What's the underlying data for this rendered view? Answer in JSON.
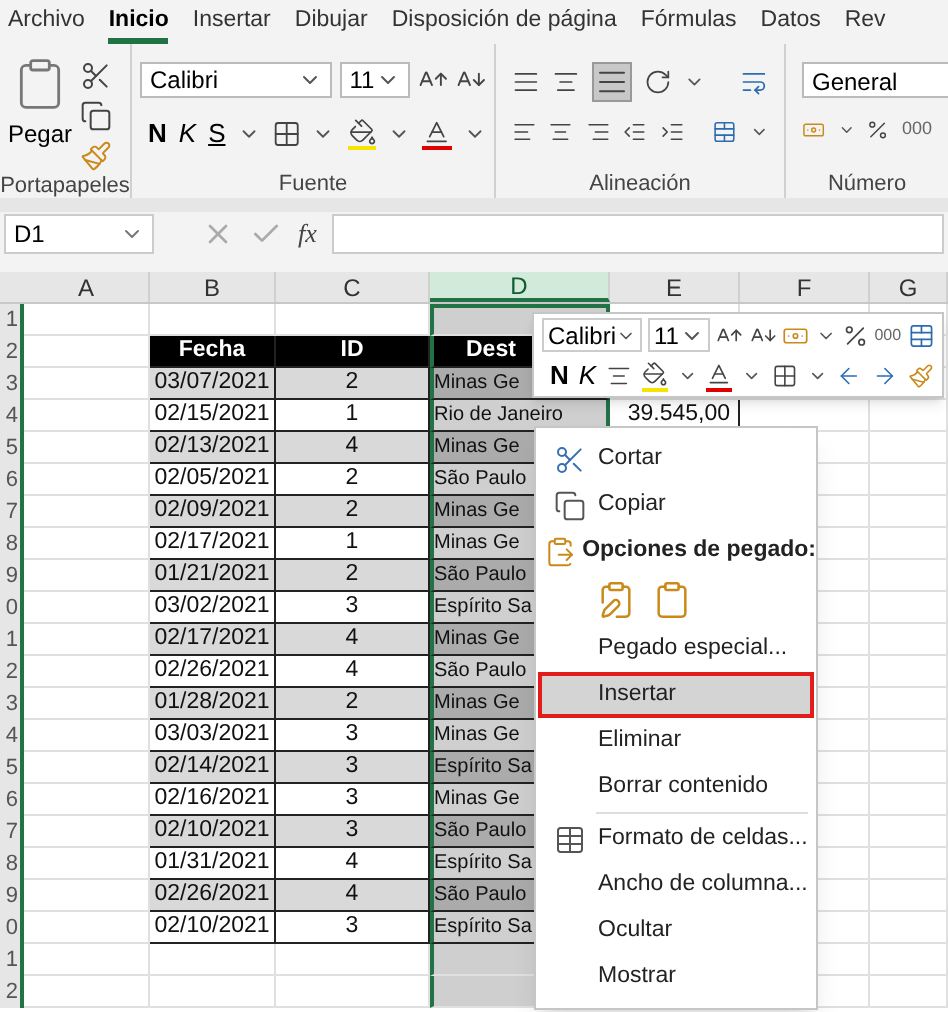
{
  "tabs": [
    {
      "label": "Archivo",
      "selected": false
    },
    {
      "label": "Inicio",
      "selected": true
    },
    {
      "label": "Insertar",
      "selected": false
    },
    {
      "label": "Dibujar",
      "selected": false
    },
    {
      "label": "Disposición de página",
      "selected": false
    },
    {
      "label": "Fórmulas",
      "selected": false
    },
    {
      "label": "Datos",
      "selected": false
    },
    {
      "label": "Rev",
      "selected": false
    }
  ],
  "ribbon": {
    "paste_label": "Pegar",
    "font": "Calibri",
    "font_size": "11",
    "bold": "N",
    "italic": "K",
    "underline": "S",
    "number_format": "General",
    "thousands": "000",
    "groups": [
      "Portapapeles",
      "Fuente",
      "Alineación",
      "Número"
    ]
  },
  "formula_bar": {
    "name_box": "D1",
    "fx": "fx"
  },
  "columns": [
    {
      "label": "A",
      "selected": false
    },
    {
      "label": "B",
      "selected": false
    },
    {
      "label": "C",
      "selected": false
    },
    {
      "label": "D",
      "selected": true
    },
    {
      "label": "E",
      "selected": false
    },
    {
      "label": "F",
      "selected": false
    },
    {
      "label": "G",
      "selected": false
    }
  ],
  "row_numbers": [
    "1",
    "2",
    "3",
    "4",
    "5",
    "6",
    "7",
    "8",
    "9",
    "0",
    "1",
    "2",
    "3",
    "4",
    "5",
    "6",
    "7",
    "8",
    "9",
    "0",
    "1",
    "2"
  ],
  "table": {
    "headers": [
      "Fecha",
      "ID",
      "Dest"
    ],
    "rows": [
      {
        "fecha": "03/07/2021",
        "id": "2",
        "dest": "Minas Ge"
      },
      {
        "fecha": "02/15/2021",
        "id": "1",
        "dest": "Rio de Janeiro"
      },
      {
        "fecha": "02/13/2021",
        "id": "4",
        "dest": "Minas Ge"
      },
      {
        "fecha": "02/05/2021",
        "id": "2",
        "dest": "São Paulo"
      },
      {
        "fecha": "02/09/2021",
        "id": "2",
        "dest": "Minas Ge"
      },
      {
        "fecha": "02/17/2021",
        "id": "1",
        "dest": "Minas Ge"
      },
      {
        "fecha": "01/21/2021",
        "id": "2",
        "dest": "São Paulo"
      },
      {
        "fecha": "03/02/2021",
        "id": "3",
        "dest": "Espírito Sa"
      },
      {
        "fecha": "02/17/2021",
        "id": "4",
        "dest": "Minas Ge"
      },
      {
        "fecha": "02/26/2021",
        "id": "4",
        "dest": "São Paulo"
      },
      {
        "fecha": "01/28/2021",
        "id": "2",
        "dest": "Minas Ge"
      },
      {
        "fecha": "03/03/2021",
        "id": "3",
        "dest": "Minas Ge"
      },
      {
        "fecha": "02/14/2021",
        "id": "3",
        "dest": "Espírito Sa"
      },
      {
        "fecha": "02/16/2021",
        "id": "3",
        "dest": "Minas Ge"
      },
      {
        "fecha": "02/10/2021",
        "id": "3",
        "dest": "São Paulo"
      },
      {
        "fecha": "01/31/2021",
        "id": "4",
        "dest": "Espírito Sa"
      },
      {
        "fecha": "02/26/2021",
        "id": "4",
        "dest": "São Paulo"
      },
      {
        "fecha": "02/10/2021",
        "id": "3",
        "dest": "Espírito Sa"
      }
    ]
  },
  "extra_cell": "39.545,00",
  "mini_toolbar": {
    "font": "Calibri",
    "size": "11",
    "bold": "N",
    "italic": "K",
    "thousands": "000"
  },
  "context_menu": {
    "items": [
      {
        "kind": "item",
        "label": "Cortar",
        "selected": false
      },
      {
        "kind": "item",
        "label": "Copiar",
        "selected": false
      },
      {
        "kind": "header",
        "label": "Opciones de pegado:"
      },
      {
        "kind": "paste_options"
      },
      {
        "kind": "item",
        "label": "Pegado especial...",
        "selected": false
      },
      {
        "kind": "item",
        "label": "Insertar",
        "selected": true
      },
      {
        "kind": "item",
        "label": "Eliminar",
        "selected": false
      },
      {
        "kind": "item",
        "label": "Borrar contenido",
        "selected": false
      },
      {
        "kind": "separator"
      },
      {
        "kind": "item",
        "label": "Formato de celdas...",
        "selected": false
      },
      {
        "kind": "item",
        "label": "Ancho de columna...",
        "selected": false
      },
      {
        "kind": "item",
        "label": "Ocultar",
        "selected": false
      },
      {
        "kind": "item",
        "label": "Mostrar",
        "selected": false
      }
    ]
  }
}
